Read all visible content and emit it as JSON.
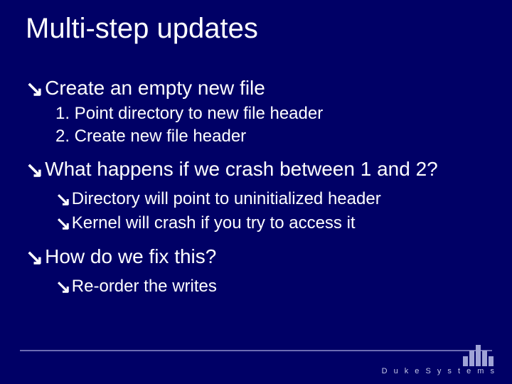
{
  "title": "Multi-step updates",
  "bullets": {
    "b1_1": "Create an empty new file",
    "n1_1": "1.  Point directory to new file header",
    "n1_2": "2.  Create new file header",
    "b1_2": "What happens if we crash between 1 and 2?",
    "b2_1": "Directory will point to uninitialized header",
    "b2_2": "Kernel will crash if you try to access it",
    "b1_3": "How do we fix this?",
    "b2_3": "Re-order the writes"
  },
  "arrow_glyph": "ê",
  "footer": {
    "brand": "D u k e   S y s t e m s"
  }
}
